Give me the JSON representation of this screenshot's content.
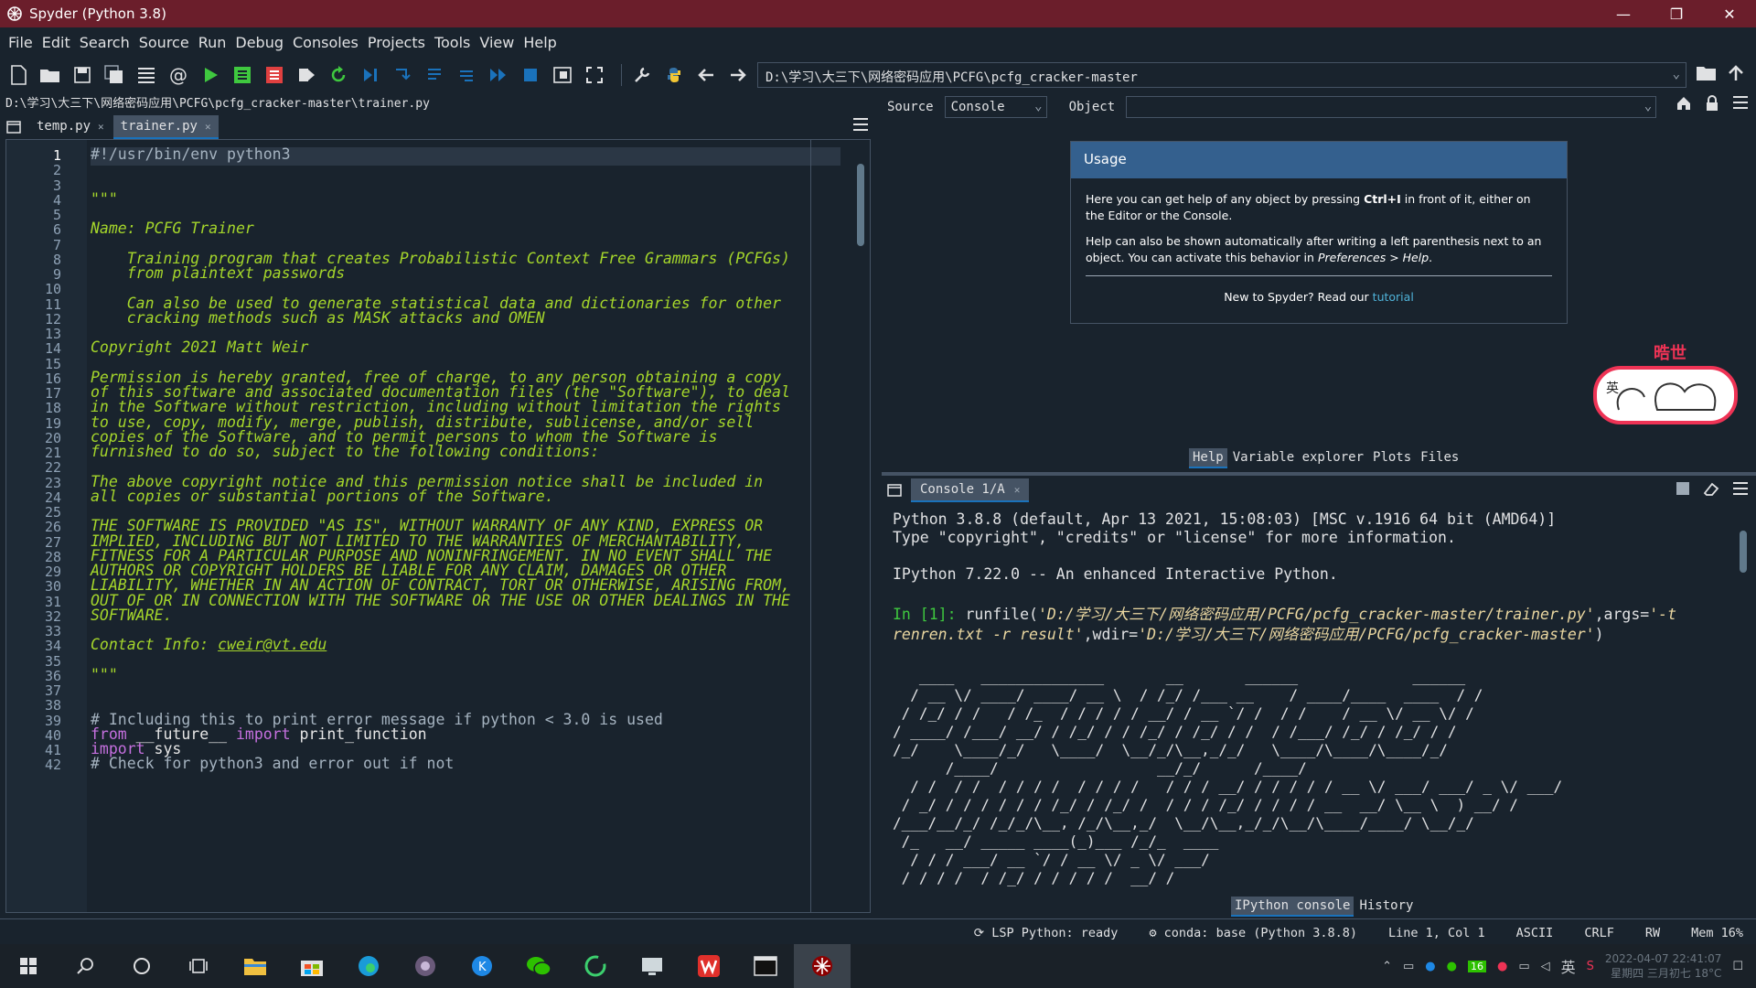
{
  "window": {
    "title": "Spyder (Python 3.8)",
    "minimize": "—",
    "maximize": "❐",
    "close": "✕"
  },
  "menu": [
    "File",
    "Edit",
    "Search",
    "Source",
    "Run",
    "Debug",
    "Consoles",
    "Projects",
    "Tools",
    "View",
    "Help"
  ],
  "toolbar": {
    "working_dir": "D:\\学习\\大三下\\网络密码应用\\PCFG\\pcfg_cracker-master"
  },
  "editor": {
    "file_path": "D:\\学习\\大三下\\网络密码应用\\PCFG\\pcfg_cracker-master\\trainer.py",
    "tabs": [
      {
        "label": "temp.py"
      },
      {
        "label": "trainer.py"
      }
    ],
    "lines": [
      {
        "n": "1",
        "t": "#!/usr/bin/env python3",
        "k": "comment"
      },
      {
        "n": "2",
        "t": "",
        "k": "doc"
      },
      {
        "n": "3",
        "t": "",
        "k": "doc"
      },
      {
        "n": "4",
        "t": "\"\"\"",
        "k": "doc"
      },
      {
        "n": "5",
        "t": "",
        "k": "doc"
      },
      {
        "n": "6",
        "t": "Name: PCFG Trainer",
        "k": "doc"
      },
      {
        "n": "7",
        "t": "",
        "k": "doc"
      },
      {
        "n": "8",
        "t": "    Training program that creates Probabilistic Context Free Grammars (PCFGs)",
        "k": "doc"
      },
      {
        "n": "9",
        "t": "    from plaintext passwords",
        "k": "doc"
      },
      {
        "n": "10",
        "t": "",
        "k": "doc"
      },
      {
        "n": "11",
        "t": "    Can also be used to generate statistical data and dictionaries for other",
        "k": "doc"
      },
      {
        "n": "12",
        "t": "    cracking methods such as MASK attacks and OMEN",
        "k": "doc"
      },
      {
        "n": "13",
        "t": "",
        "k": "doc"
      },
      {
        "n": "14",
        "t": "Copyright 2021 Matt Weir",
        "k": "doc"
      },
      {
        "n": "15",
        "t": "",
        "k": "doc"
      },
      {
        "n": "16",
        "t": "Permission is hereby granted, free of charge, to any person obtaining a copy",
        "k": "doc"
      },
      {
        "n": "17",
        "t": "of this software and associated documentation files (the \"Software\"), to deal",
        "k": "doc"
      },
      {
        "n": "18",
        "t": "in the Software without restriction, including without limitation the rights",
        "k": "doc"
      },
      {
        "n": "19",
        "t": "to use, copy, modify, merge, publish, distribute, sublicense, and/or sell",
        "k": "doc"
      },
      {
        "n": "20",
        "t": "copies of the Software, and to permit persons to whom the Software is",
        "k": "doc"
      },
      {
        "n": "21",
        "t": "furnished to do so, subject to the following conditions:",
        "k": "doc"
      },
      {
        "n": "22",
        "t": "",
        "k": "doc"
      },
      {
        "n": "23",
        "t": "The above copyright notice and this permission notice shall be included in",
        "k": "doc"
      },
      {
        "n": "24",
        "t": "all copies or substantial portions of the Software.",
        "k": "doc"
      },
      {
        "n": "25",
        "t": "",
        "k": "doc"
      },
      {
        "n": "26",
        "t": "THE SOFTWARE IS PROVIDED \"AS IS\", WITHOUT WARRANTY OF ANY KIND, EXPRESS OR",
        "k": "doc"
      },
      {
        "n": "27",
        "t": "IMPLIED, INCLUDING BUT NOT LIMITED TO THE WARRANTIES OF MERCHANTABILITY,",
        "k": "doc"
      },
      {
        "n": "28",
        "t": "FITNESS FOR A PARTICULAR PURPOSE AND NONINFRINGEMENT. IN NO EVENT SHALL THE",
        "k": "doc"
      },
      {
        "n": "29",
        "t": "AUTHORS OR COPYRIGHT HOLDERS BE LIABLE FOR ANY CLAIM, DAMAGES OR OTHER",
        "k": "doc"
      },
      {
        "n": "30",
        "t": "LIABILITY, WHETHER IN AN ACTION OF CONTRACT, TORT OR OTHERWISE, ARISING FROM,",
        "k": "doc"
      },
      {
        "n": "31",
        "t": "OUT OF OR IN CONNECTION WITH THE SOFTWARE OR THE USE OR OTHER DEALINGS IN THE",
        "k": "doc"
      },
      {
        "n": "32",
        "t": "SOFTWARE.",
        "k": "doc"
      },
      {
        "n": "33",
        "t": "",
        "k": "doc"
      },
      {
        "n": "34",
        "t": "Contact Info: ",
        "k": "doc",
        "link": "cweir@vt.edu"
      },
      {
        "n": "35",
        "t": "",
        "k": "doc"
      },
      {
        "n": "36",
        "t": "\"\"\"",
        "k": "doc"
      },
      {
        "n": "37",
        "t": "",
        "k": "doc"
      },
      {
        "n": "38",
        "t": "",
        "k": "doc"
      },
      {
        "n": "39",
        "t": "# Including this to print error message if python < 3.0 is used",
        "k": "comment"
      },
      {
        "n": "40",
        "t": "from __future__ import print_function",
        "k": "code"
      },
      {
        "n": "41",
        "t": "import sys",
        "k": "code"
      },
      {
        "n": "42",
        "t": "# Check for python3 and error out if not",
        "k": "comment"
      }
    ]
  },
  "help": {
    "source_label": "Source",
    "source_value": "Console",
    "object_label": "Object",
    "object_value": "",
    "usage_title": "Usage",
    "p1_a": "Here you can get help of any object by pressing ",
    "p1_b": "Ctrl+I",
    "p1_c": " in front of it, either on the Editor or the Console.",
    "p2_a": "Help can also be shown automatically after writing a left parenthesis next to an object. You can activate this behavior in ",
    "p2_b": "Preferences > Help",
    "p2_c": ".",
    "new_text": "New to Spyder? Read our ",
    "tutorial": "tutorial",
    "sticker_top": "晧世",
    "sticker_left": "英"
  },
  "top_tabs": [
    "Help",
    "Variable explorer",
    "Plots",
    "Files"
  ],
  "console": {
    "tab": "Console 1/A",
    "l1": "Python 3.8.8 (default, Apr 13 2021, 15:08:03) [MSC v.1916 64 bit (AMD64)]",
    "l2": "Type \"copyright\", \"credits\" or \"license\" for more information.",
    "l3": "IPython 7.22.0 -- An enhanced Interactive Python.",
    "prompt": "In [1]:",
    "cmd_a": " runfile(",
    "cmd_b": "'D:/学习/大三下/网络密码应用/PCFG/pcfg_cracker-master/trainer.py'",
    "cmd_c": ",args=",
    "cmd_d": "'-t",
    "cmd_e": "renren.txt -r result'",
    "cmd_f": ",wdir=",
    "cmd_g": "'D:/学习/大三下/网络密码应用/PCFG/pcfg_cracker-master'",
    "cmd_h": ")",
    "ascii": "   ____   ______________       __       ______             ______\n  / __ \\/ ____/ ____/ __ \\  / /_/ /___ __    / ____/____  ____  / /\n / /_/ / /   / /_  / / / / / __/ / __ `/ /  / /    / __ \\/ __ \\/ /\n/ ____/ /___/ __/ / /_/ / / /_/ / /_/ / /  / /___/ /_/ / /_/ / /\n/_/    \\____/_/   \\____/  \\__/_/\\__,_/_/   \\____/\\____/\\____/_/\n      /____/                  __/_/      /____/\n  / /  / /  / / / /  / / / /   / / / __/ / / / / / __ \\/ ___/ ___/ _ \\/ ___/\n / _/ / / / / / / /_/ / /_/ /  / / / /_/ / / / / __  __/ \\__ \\  ) __/ /\n/___/__/_/ /_/_/\\__, /_/\\__,_/  \\__/\\__,_/_/\\__/\\____/____/ \\__/_/\n /_   __/ _____ ____(_)___ /_/_  ____\n  / / / ___/ __ `/ / __ \\/ _ \\/ ___/\n / / / /  / /_/ / / / / /  __/ /\n/ / / /    \\__,_/_/_/ /_/\\___/_/"
  },
  "bottom_tabs": [
    "IPython console",
    "History"
  ],
  "status": {
    "lsp": "LSP Python: ready",
    "conda": "conda: base (Python 3.8.8)",
    "pos": "Line 1, Col 1",
    "enc": "ASCII",
    "eol": "CRLF",
    "rw": "RW",
    "mem": "Mem 16%"
  },
  "tray": {
    "badge": "16",
    "ime": "英",
    "date": "2022-04-07 22:41:07",
    "weekday": "星期四 三月初七 18°C"
  },
  "colors": {
    "accent": "#1a72bb",
    "titlebar": "#6b1e2b",
    "background": "#19232d",
    "docstring": "#a5d62b"
  }
}
